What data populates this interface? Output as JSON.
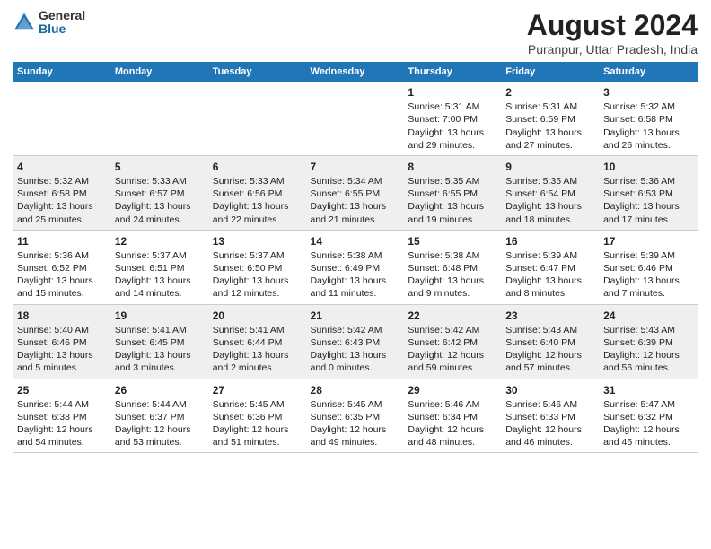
{
  "logo": {
    "general": "General",
    "blue": "Blue"
  },
  "title": "August 2024",
  "subtitle": "Puranpur, Uttar Pradesh, India",
  "days_of_week": [
    "Sunday",
    "Monday",
    "Tuesday",
    "Wednesday",
    "Thursday",
    "Friday",
    "Saturday"
  ],
  "weeks": [
    {
      "id": "week1",
      "days": [
        {
          "num": "",
          "sunrise": "",
          "sunset": "",
          "daylight": "",
          "empty": true
        },
        {
          "num": "",
          "sunrise": "",
          "sunset": "",
          "daylight": "",
          "empty": true
        },
        {
          "num": "",
          "sunrise": "",
          "sunset": "",
          "daylight": "",
          "empty": true
        },
        {
          "num": "",
          "sunrise": "",
          "sunset": "",
          "daylight": "",
          "empty": true
        },
        {
          "num": "1",
          "sunrise": "Sunrise: 5:31 AM",
          "sunset": "Sunset: 7:00 PM",
          "daylight": "Daylight: 13 hours and 29 minutes.",
          "empty": false
        },
        {
          "num": "2",
          "sunrise": "Sunrise: 5:31 AM",
          "sunset": "Sunset: 6:59 PM",
          "daylight": "Daylight: 13 hours and 27 minutes.",
          "empty": false
        },
        {
          "num": "3",
          "sunrise": "Sunrise: 5:32 AM",
          "sunset": "Sunset: 6:58 PM",
          "daylight": "Daylight: 13 hours and 26 minutes.",
          "empty": false
        }
      ]
    },
    {
      "id": "week2",
      "days": [
        {
          "num": "4",
          "sunrise": "Sunrise: 5:32 AM",
          "sunset": "Sunset: 6:58 PM",
          "daylight": "Daylight: 13 hours and 25 minutes.",
          "empty": false
        },
        {
          "num": "5",
          "sunrise": "Sunrise: 5:33 AM",
          "sunset": "Sunset: 6:57 PM",
          "daylight": "Daylight: 13 hours and 24 minutes.",
          "empty": false
        },
        {
          "num": "6",
          "sunrise": "Sunrise: 5:33 AM",
          "sunset": "Sunset: 6:56 PM",
          "daylight": "Daylight: 13 hours and 22 minutes.",
          "empty": false
        },
        {
          "num": "7",
          "sunrise": "Sunrise: 5:34 AM",
          "sunset": "Sunset: 6:55 PM",
          "daylight": "Daylight: 13 hours and 21 minutes.",
          "empty": false
        },
        {
          "num": "8",
          "sunrise": "Sunrise: 5:35 AM",
          "sunset": "Sunset: 6:55 PM",
          "daylight": "Daylight: 13 hours and 19 minutes.",
          "empty": false
        },
        {
          "num": "9",
          "sunrise": "Sunrise: 5:35 AM",
          "sunset": "Sunset: 6:54 PM",
          "daylight": "Daylight: 13 hours and 18 minutes.",
          "empty": false
        },
        {
          "num": "10",
          "sunrise": "Sunrise: 5:36 AM",
          "sunset": "Sunset: 6:53 PM",
          "daylight": "Daylight: 13 hours and 17 minutes.",
          "empty": false
        }
      ]
    },
    {
      "id": "week3",
      "days": [
        {
          "num": "11",
          "sunrise": "Sunrise: 5:36 AM",
          "sunset": "Sunset: 6:52 PM",
          "daylight": "Daylight: 13 hours and 15 minutes.",
          "empty": false
        },
        {
          "num": "12",
          "sunrise": "Sunrise: 5:37 AM",
          "sunset": "Sunset: 6:51 PM",
          "daylight": "Daylight: 13 hours and 14 minutes.",
          "empty": false
        },
        {
          "num": "13",
          "sunrise": "Sunrise: 5:37 AM",
          "sunset": "Sunset: 6:50 PM",
          "daylight": "Daylight: 13 hours and 12 minutes.",
          "empty": false
        },
        {
          "num": "14",
          "sunrise": "Sunrise: 5:38 AM",
          "sunset": "Sunset: 6:49 PM",
          "daylight": "Daylight: 13 hours and 11 minutes.",
          "empty": false
        },
        {
          "num": "15",
          "sunrise": "Sunrise: 5:38 AM",
          "sunset": "Sunset: 6:48 PM",
          "daylight": "Daylight: 13 hours and 9 minutes.",
          "empty": false
        },
        {
          "num": "16",
          "sunrise": "Sunrise: 5:39 AM",
          "sunset": "Sunset: 6:47 PM",
          "daylight": "Daylight: 13 hours and 8 minutes.",
          "empty": false
        },
        {
          "num": "17",
          "sunrise": "Sunrise: 5:39 AM",
          "sunset": "Sunset: 6:46 PM",
          "daylight": "Daylight: 13 hours and 7 minutes.",
          "empty": false
        }
      ]
    },
    {
      "id": "week4",
      "days": [
        {
          "num": "18",
          "sunrise": "Sunrise: 5:40 AM",
          "sunset": "Sunset: 6:46 PM",
          "daylight": "Daylight: 13 hours and 5 minutes.",
          "empty": false
        },
        {
          "num": "19",
          "sunrise": "Sunrise: 5:41 AM",
          "sunset": "Sunset: 6:45 PM",
          "daylight": "Daylight: 13 hours and 3 minutes.",
          "empty": false
        },
        {
          "num": "20",
          "sunrise": "Sunrise: 5:41 AM",
          "sunset": "Sunset: 6:44 PM",
          "daylight": "Daylight: 13 hours and 2 minutes.",
          "empty": false
        },
        {
          "num": "21",
          "sunrise": "Sunrise: 5:42 AM",
          "sunset": "Sunset: 6:43 PM",
          "daylight": "Daylight: 13 hours and 0 minutes.",
          "empty": false
        },
        {
          "num": "22",
          "sunrise": "Sunrise: 5:42 AM",
          "sunset": "Sunset: 6:42 PM",
          "daylight": "Daylight: 12 hours and 59 minutes.",
          "empty": false
        },
        {
          "num": "23",
          "sunrise": "Sunrise: 5:43 AM",
          "sunset": "Sunset: 6:40 PM",
          "daylight": "Daylight: 12 hours and 57 minutes.",
          "empty": false
        },
        {
          "num": "24",
          "sunrise": "Sunrise: 5:43 AM",
          "sunset": "Sunset: 6:39 PM",
          "daylight": "Daylight: 12 hours and 56 minutes.",
          "empty": false
        }
      ]
    },
    {
      "id": "week5",
      "days": [
        {
          "num": "25",
          "sunrise": "Sunrise: 5:44 AM",
          "sunset": "Sunset: 6:38 PM",
          "daylight": "Daylight: 12 hours and 54 minutes.",
          "empty": false
        },
        {
          "num": "26",
          "sunrise": "Sunrise: 5:44 AM",
          "sunset": "Sunset: 6:37 PM",
          "daylight": "Daylight: 12 hours and 53 minutes.",
          "empty": false
        },
        {
          "num": "27",
          "sunrise": "Sunrise: 5:45 AM",
          "sunset": "Sunset: 6:36 PM",
          "daylight": "Daylight: 12 hours and 51 minutes.",
          "empty": false
        },
        {
          "num": "28",
          "sunrise": "Sunrise: 5:45 AM",
          "sunset": "Sunset: 6:35 PM",
          "daylight": "Daylight: 12 hours and 49 minutes.",
          "empty": false
        },
        {
          "num": "29",
          "sunrise": "Sunrise: 5:46 AM",
          "sunset": "Sunset: 6:34 PM",
          "daylight": "Daylight: 12 hours and 48 minutes.",
          "empty": false
        },
        {
          "num": "30",
          "sunrise": "Sunrise: 5:46 AM",
          "sunset": "Sunset: 6:33 PM",
          "daylight": "Daylight: 12 hours and 46 minutes.",
          "empty": false
        },
        {
          "num": "31",
          "sunrise": "Sunrise: 5:47 AM",
          "sunset": "Sunset: 6:32 PM",
          "daylight": "Daylight: 12 hours and 45 minutes.",
          "empty": false
        }
      ]
    }
  ]
}
